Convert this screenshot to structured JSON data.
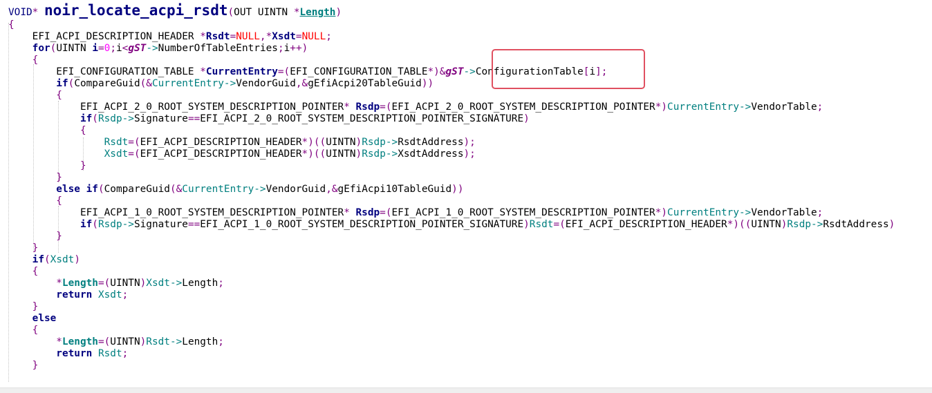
{
  "editor": {
    "lines": [
      [
        [
          "t-kw-thin",
          "VOID"
        ],
        [
          "t-op",
          "* "
        ],
        [
          "t-fn",
          "noir_locate_acpi_rsdt"
        ],
        [
          "t-op",
          "("
        ],
        [
          "t-plain",
          "OUT UINTN "
        ],
        [
          "t-op",
          "*"
        ],
        [
          "t-param",
          "Length"
        ],
        [
          "t-op",
          ")"
        ]
      ],
      [
        [
          "t-brace",
          "{"
        ]
      ],
      [
        [
          "t-plain",
          "    EFI_ACPI_DESCRIPTION_HEADER "
        ],
        [
          "t-op",
          "*"
        ],
        [
          "t-bvar",
          "Rsdt"
        ],
        [
          "t-op",
          "="
        ],
        [
          "t-const",
          "NULL"
        ],
        [
          "t-op",
          ","
        ],
        [
          "t-op",
          "*"
        ],
        [
          "t-bvar",
          "Xsdt"
        ],
        [
          "t-op",
          "="
        ],
        [
          "t-const",
          "NULL"
        ],
        [
          "t-op",
          ";"
        ]
      ],
      [
        [
          "t-kw",
          "    for"
        ],
        [
          "t-op",
          "("
        ],
        [
          "t-plain",
          "UINTN "
        ],
        [
          "t-bvar",
          "i"
        ],
        [
          "t-op",
          "="
        ],
        [
          "t-num",
          "0"
        ],
        [
          "t-op",
          ";"
        ],
        [
          "t-plain",
          "i"
        ],
        [
          "t-op",
          "<"
        ],
        [
          "t-global",
          "gST"
        ],
        [
          "t-arrow",
          "->"
        ],
        [
          "t-plain",
          "NumberOfTableEntries"
        ],
        [
          "t-op",
          ";"
        ],
        [
          "t-plain",
          "i"
        ],
        [
          "t-op",
          "++)"
        ]
      ],
      [
        [
          "t-brace",
          "    {"
        ]
      ],
      [
        [
          "t-plain",
          "        EFI_CONFIGURATION_TABLE "
        ],
        [
          "t-op",
          "*"
        ],
        [
          "t-bvar",
          "CurrentEntry"
        ],
        [
          "t-op",
          "=("
        ],
        [
          "t-plain",
          "EFI_CONFIGURATION_TABLE"
        ],
        [
          "t-op",
          "*)&"
        ],
        [
          "t-global",
          "gST"
        ],
        [
          "t-arrow",
          "->"
        ],
        [
          "t-plain",
          "ConfigurationTable"
        ],
        [
          "t-op",
          "["
        ],
        [
          "t-plain",
          "i"
        ],
        [
          "t-op",
          "];"
        ]
      ],
      [
        [
          "t-kw",
          "        if"
        ],
        [
          "t-op",
          "("
        ],
        [
          "t-plain",
          "CompareGuid"
        ],
        [
          "t-op",
          "(&"
        ],
        [
          "t-var",
          "CurrentEntry"
        ],
        [
          "t-arrow",
          "->"
        ],
        [
          "t-plain",
          "VendorGuid"
        ],
        [
          "t-op",
          ",&"
        ],
        [
          "t-plain",
          "gEfiAcpi20TableGuid"
        ],
        [
          "t-op",
          "))"
        ]
      ],
      [
        [
          "t-brace",
          "        {"
        ]
      ],
      [
        [
          "t-plain",
          "            EFI_ACPI_2_0_ROOT_SYSTEM_DESCRIPTION_POINTER"
        ],
        [
          "t-op",
          "* "
        ],
        [
          "t-bvar",
          "Rsdp"
        ],
        [
          "t-op",
          "=("
        ],
        [
          "t-plain",
          "EFI_ACPI_2_0_ROOT_SYSTEM_DESCRIPTION_POINTER"
        ],
        [
          "t-op",
          "*)"
        ],
        [
          "t-var",
          "CurrentEntry"
        ],
        [
          "t-arrow",
          "->"
        ],
        [
          "t-plain",
          "VendorTable"
        ],
        [
          "t-op",
          ";"
        ]
      ],
      [
        [
          "t-kw",
          "            if"
        ],
        [
          "t-op",
          "("
        ],
        [
          "t-var",
          "Rsdp"
        ],
        [
          "t-arrow",
          "->"
        ],
        [
          "t-plain",
          "Signature"
        ],
        [
          "t-op",
          "=="
        ],
        [
          "t-plain",
          "EFI_ACPI_2_0_ROOT_SYSTEM_DESCRIPTION_POINTER_SIGNATURE"
        ],
        [
          "t-op",
          ")"
        ]
      ],
      [
        [
          "t-brace",
          "            {"
        ]
      ],
      [
        [
          "t-var",
          "                Rsdt"
        ],
        [
          "t-op",
          "=("
        ],
        [
          "t-plain",
          "EFI_ACPI_DESCRIPTION_HEADER"
        ],
        [
          "t-op",
          "*)(("
        ],
        [
          "t-plain",
          "UINTN"
        ],
        [
          "t-op",
          ")"
        ],
        [
          "t-var",
          "Rsdp"
        ],
        [
          "t-arrow",
          "->"
        ],
        [
          "t-plain",
          "RsdtAddress"
        ],
        [
          "t-op",
          ");"
        ]
      ],
      [
        [
          "t-var",
          "                Xsdt"
        ],
        [
          "t-op",
          "=("
        ],
        [
          "t-plain",
          "EFI_ACPI_DESCRIPTION_HEADER"
        ],
        [
          "t-op",
          "*)(("
        ],
        [
          "t-plain",
          "UINTN"
        ],
        [
          "t-op",
          ")"
        ],
        [
          "t-var",
          "Rsdp"
        ],
        [
          "t-arrow",
          "->"
        ],
        [
          "t-plain",
          "XsdtAddress"
        ],
        [
          "t-op",
          ");"
        ]
      ],
      [
        [
          "t-brace",
          "            }"
        ]
      ],
      [
        [
          "t-brace",
          "        }"
        ]
      ],
      [
        [
          "t-kw",
          "        else if"
        ],
        [
          "t-op",
          "("
        ],
        [
          "t-plain",
          "CompareGuid"
        ],
        [
          "t-op",
          "(&"
        ],
        [
          "t-var",
          "CurrentEntry"
        ],
        [
          "t-arrow",
          "->"
        ],
        [
          "t-plain",
          "VendorGuid"
        ],
        [
          "t-op",
          ",&"
        ],
        [
          "t-plain",
          "gEfiAcpi10TableGuid"
        ],
        [
          "t-op",
          "))"
        ]
      ],
      [
        [
          "t-brace",
          "        {"
        ]
      ],
      [
        [
          "t-plain",
          "            EFI_ACPI_1_0_ROOT_SYSTEM_DESCRIPTION_POINTER"
        ],
        [
          "t-op",
          "* "
        ],
        [
          "t-bvar",
          "Rsdp"
        ],
        [
          "t-op",
          "=("
        ],
        [
          "t-plain",
          "EFI_ACPI_1_0_ROOT_SYSTEM_DESCRIPTION_POINTER"
        ],
        [
          "t-op",
          "*)"
        ],
        [
          "t-var",
          "CurrentEntry"
        ],
        [
          "t-arrow",
          "->"
        ],
        [
          "t-plain",
          "VendorTable"
        ],
        [
          "t-op",
          ";"
        ]
      ],
      [
        [
          "t-kw",
          "            if"
        ],
        [
          "t-op",
          "("
        ],
        [
          "t-var",
          "Rsdp"
        ],
        [
          "t-arrow",
          "->"
        ],
        [
          "t-plain",
          "Signature"
        ],
        [
          "t-op",
          "=="
        ],
        [
          "t-plain",
          "EFI_ACPI_1_0_ROOT_SYSTEM_DESCRIPTION_POINTER_SIGNATURE"
        ],
        [
          "t-op",
          ")"
        ],
        [
          "t-var",
          "Rsdt"
        ],
        [
          "t-op",
          "=("
        ],
        [
          "t-plain",
          "EFI_ACPI_DESCRIPTION_HEADER"
        ],
        [
          "t-op",
          "*)(("
        ],
        [
          "t-plain",
          "UINTN"
        ],
        [
          "t-op",
          ")"
        ],
        [
          "t-var",
          "Rsdp"
        ],
        [
          "t-arrow",
          "->"
        ],
        [
          "t-plain",
          "RsdtAddress"
        ],
        [
          "t-op",
          ")"
        ]
      ],
      [
        [
          "t-brace",
          "        }"
        ]
      ],
      [
        [
          "t-brace",
          "    }"
        ]
      ],
      [
        [
          "t-kw",
          "    if"
        ],
        [
          "t-op",
          "("
        ],
        [
          "t-var",
          "Xsdt"
        ],
        [
          "t-op",
          ")"
        ]
      ],
      [
        [
          "t-brace",
          "    {"
        ]
      ],
      [
        [
          "t-op",
          "        *"
        ],
        [
          "t-param-nu",
          "Length"
        ],
        [
          "t-op",
          "=("
        ],
        [
          "t-plain",
          "UINTN"
        ],
        [
          "t-op",
          ")"
        ],
        [
          "t-var",
          "Xsdt"
        ],
        [
          "t-arrow",
          "->"
        ],
        [
          "t-plain",
          "Length"
        ],
        [
          "t-op",
          ";"
        ]
      ],
      [
        [
          "t-kw",
          "        return "
        ],
        [
          "t-var",
          "Xsdt"
        ],
        [
          "t-op",
          ";"
        ]
      ],
      [
        [
          "t-brace",
          "    }"
        ]
      ],
      [
        [
          "t-kw",
          "    else"
        ]
      ],
      [
        [
          "t-brace",
          "    {"
        ]
      ],
      [
        [
          "t-op",
          "        *"
        ],
        [
          "t-param-nu",
          "Length"
        ],
        [
          "t-op",
          "=("
        ],
        [
          "t-plain",
          "UINTN"
        ],
        [
          "t-op",
          ")"
        ],
        [
          "t-var",
          "Rsdt"
        ],
        [
          "t-arrow",
          "->"
        ],
        [
          "t-plain",
          "Length"
        ],
        [
          "t-op",
          ";"
        ]
      ],
      [
        [
          "t-kw",
          "        return "
        ],
        [
          "t-var",
          "Rsdt"
        ],
        [
          "t-op",
          ";"
        ]
      ],
      [
        [
          "t-brace",
          "    }"
        ]
      ]
    ]
  },
  "colors": {
    "highlight_box": "#e05060",
    "background": "#ffffff",
    "keyword": "#00007f",
    "variable": "#007f7f",
    "operator": "#7f007f",
    "constant": "#ff0000",
    "number": "#ff00ff"
  }
}
